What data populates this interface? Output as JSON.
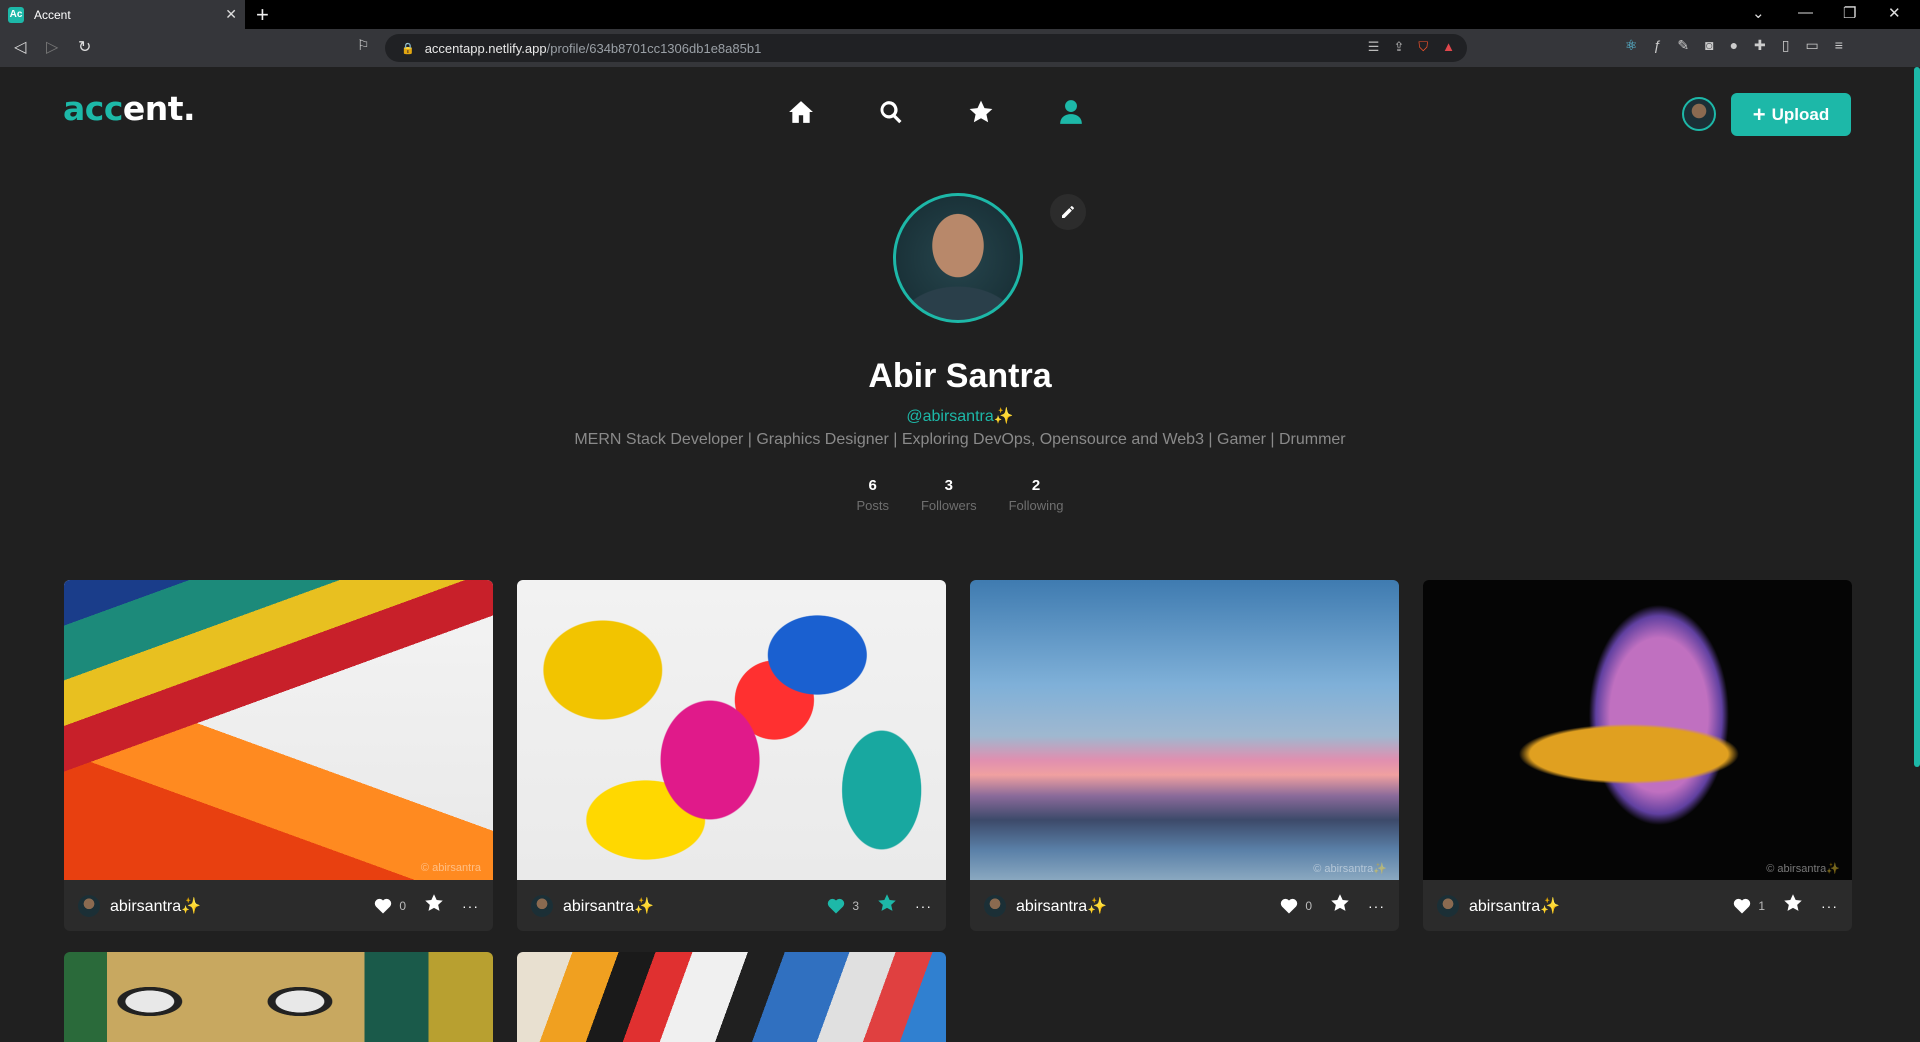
{
  "browser": {
    "tab_title": "Accent",
    "tab_favicon": "Ac",
    "url_host": "accentapp.netlify.app",
    "url_path": "/profile/634b8701cc1306db1e8a85b1"
  },
  "app": {
    "logo_accent": "acc",
    "logo_rest": "ent.",
    "upload_label": "Upload",
    "accent_color": "#1db8a8"
  },
  "profile": {
    "name": "Abir Santra",
    "handle": "@abirsantra✨",
    "bio": "MERN Stack Developer | Graphics Designer | Exploring DevOps, Opensource and Web3 | Gamer | Drummer",
    "stats": [
      {
        "value": "6",
        "label": "Posts"
      },
      {
        "value": "3",
        "label": "Followers"
      },
      {
        "value": "2",
        "label": "Following"
      }
    ]
  },
  "posts": [
    {
      "user": "abirsantra✨",
      "likes": "0",
      "liked": false,
      "starred": false,
      "watermark": "© abirsantra"
    },
    {
      "user": "abirsantra✨",
      "likes": "3",
      "liked": true,
      "starred": true,
      "watermark": ""
    },
    {
      "user": "abirsantra✨",
      "likes": "0",
      "liked": false,
      "starred": false,
      "watermark": "© abirsantra✨"
    },
    {
      "user": "abirsantra✨",
      "likes": "1",
      "liked": false,
      "starred": false,
      "watermark": "© abirsantra✨"
    }
  ],
  "more_label": "···"
}
